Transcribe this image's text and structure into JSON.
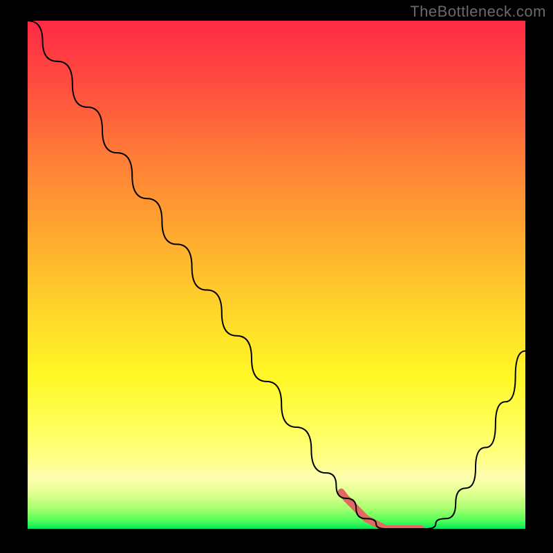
{
  "watermark": "TheBottleneck.com",
  "chart_data": {
    "type": "line",
    "title": "",
    "xlabel": "",
    "ylabel": "",
    "xlim": [
      0,
      100
    ],
    "ylim": [
      0,
      100
    ],
    "x": [
      0,
      6,
      12,
      18,
      24,
      30,
      36,
      42,
      48,
      54,
      60,
      64,
      68,
      72,
      76,
      80,
      84,
      88,
      92,
      96,
      100
    ],
    "values": [
      100,
      92,
      83,
      74,
      65,
      56,
      47,
      38,
      29,
      20,
      11,
      6,
      2,
      0,
      0,
      0,
      2,
      8,
      16,
      25,
      35
    ],
    "highlight_range_x": [
      63,
      79
    ],
    "colors": {
      "curve": "#000000",
      "highlight": "#e06a5f",
      "gradient_top": "#ff2a46",
      "gradient_bottom": "#00e85a"
    }
  }
}
